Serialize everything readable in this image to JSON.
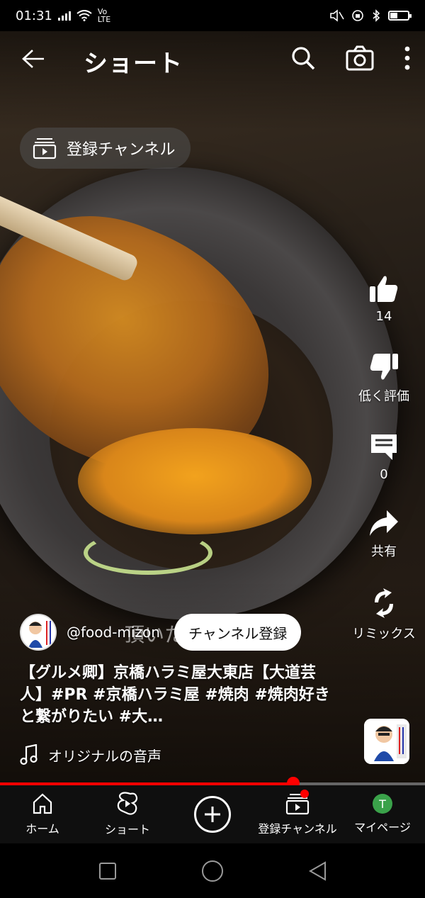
{
  "status_bar": {
    "time": "01:31",
    "network": "Vo LTE"
  },
  "header": {
    "title": "ショート"
  },
  "subscriptions_chip": {
    "label": "登録チャンネル"
  },
  "right_rail": {
    "like_count": "14",
    "dislike_label": "低く評価",
    "comment_count": "0",
    "share_label": "共有",
    "remix_label": "リミックス"
  },
  "channel": {
    "handle": "@food-mizon",
    "subscribe_label": "チャンネル登録",
    "overlay_text": "頂いた"
  },
  "caption": {
    "text": "【グルメ卿】京橋ハラミ屋大東店【大道芸人】#PR #京橋ハラミ屋 #焼肉 #焼肉好きと繋がりたい #大…"
  },
  "sound": {
    "label": "オリジナルの音声"
  },
  "progress": {
    "fraction": 0.69
  },
  "bottom_nav": {
    "items": [
      {
        "label": "ホーム"
      },
      {
        "label": "ショート"
      },
      {
        "label": ""
      },
      {
        "label": "登録チャンネル"
      },
      {
        "label": "マイページ"
      }
    ],
    "avatar_letter": "T"
  },
  "colors": {
    "accent": "#ff0000",
    "nav_bg": "#0f0f0f",
    "avatar_bg": "#3aa24a"
  }
}
